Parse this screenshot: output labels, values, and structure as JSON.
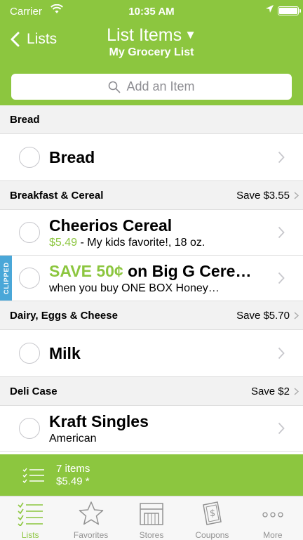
{
  "status_bar": {
    "carrier": "Carrier",
    "time": "10:35 AM"
  },
  "nav": {
    "back_label": "Lists",
    "title": "List Items",
    "subtitle": "My Grocery List"
  },
  "search": {
    "placeholder": "Add an Item"
  },
  "sections": [
    {
      "name": "Bread",
      "save": "",
      "items": [
        {
          "title": "Bread"
        }
      ]
    },
    {
      "name": "Breakfast & Cereal",
      "save": "Save $3.55",
      "items": [
        {
          "title": "Cheerios Cereal",
          "price": "$5.49",
          "note": " - My kids favorite!, 18 oz."
        },
        {
          "badge": "CLIPPED",
          "title_highlight": "SAVE 50¢",
          "title_rest": " on Big G Cere…",
          "subtitle": "when you buy ONE BOX Honey…"
        }
      ]
    },
    {
      "name": "Dairy, Eggs & Cheese",
      "save": "Save $5.70",
      "items": [
        {
          "title": "Milk"
        }
      ]
    },
    {
      "name": "Deli Case",
      "save": "Save $2",
      "items": [
        {
          "title": "Kraft Singles",
          "subtitle": "American"
        }
      ]
    }
  ],
  "summary": {
    "count": "7 items",
    "total": "$5.49 *"
  },
  "tabs": [
    {
      "label": "Lists",
      "icon": "list-icon",
      "active": true
    },
    {
      "label": "Favorites",
      "icon": "star-icon",
      "active": false
    },
    {
      "label": "Stores",
      "icon": "store-icon",
      "active": false
    },
    {
      "label": "Coupons",
      "icon": "coupon-icon",
      "active": false
    },
    {
      "label": "More",
      "icon": "more-icon",
      "active": false
    }
  ],
  "colors": {
    "accent": "#8cc63f",
    "clipped_badge": "#4aa7d8",
    "section_bg": "#f2f2f2",
    "inactive_tab": "#929292"
  }
}
